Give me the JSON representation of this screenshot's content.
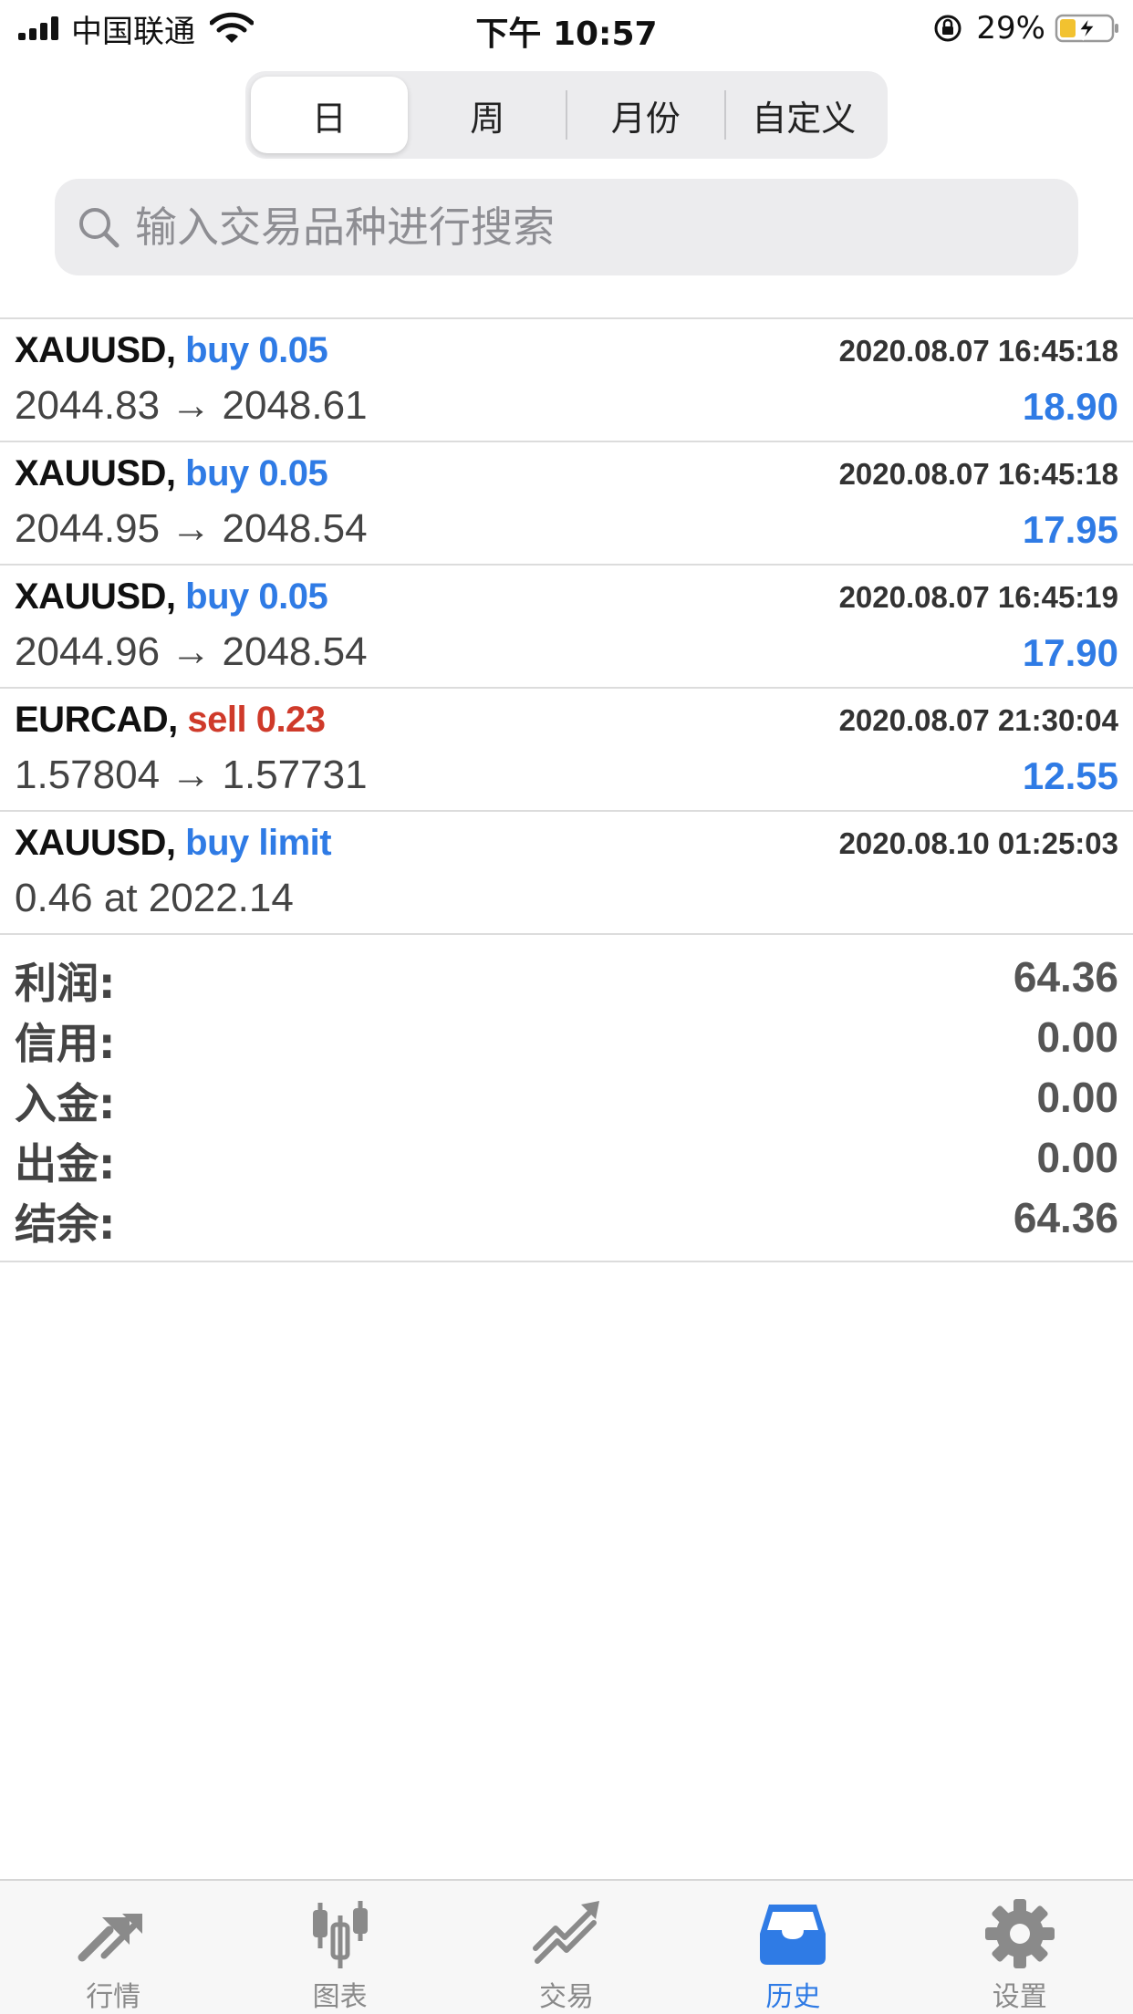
{
  "status_bar": {
    "carrier": "中国联通",
    "time": "下午 10:57",
    "battery_percent": "29%"
  },
  "segment": {
    "tabs": [
      "日",
      "周",
      "月份",
      "自定义"
    ],
    "active_index": 0
  },
  "search": {
    "placeholder": "输入交易品种进行搜索",
    "icon": "search-icon"
  },
  "trades": [
    {
      "symbol": "XAUUSD,",
      "side": "buy 0.05",
      "type": "buy",
      "time": "2020.08.07 16:45:18",
      "prices": "2044.83 → 2048.61",
      "profit": "18.90"
    },
    {
      "symbol": "XAUUSD,",
      "side": "buy 0.05",
      "type": "buy",
      "time": "2020.08.07 16:45:18",
      "prices": "2044.95 → 2048.54",
      "profit": "17.95"
    },
    {
      "symbol": "XAUUSD,",
      "side": "buy 0.05",
      "type": "buy",
      "time": "2020.08.07 16:45:19",
      "prices": "2044.96 → 2048.54",
      "profit": "17.90"
    },
    {
      "symbol": "EURCAD,",
      "side": "sell 0.23",
      "type": "sell",
      "time": "2020.08.07 21:30:04",
      "prices": "1.57804 → 1.57731",
      "profit": "12.55"
    },
    {
      "symbol": "XAUUSD,",
      "side": "buy limit",
      "type": "buy",
      "time": "2020.08.10 01:25:03",
      "prices": "0.46 at 2022.14",
      "profit": ""
    }
  ],
  "summary": [
    {
      "label": "利润:",
      "value": "64.36"
    },
    {
      "label": "信用:",
      "value": "0.00"
    },
    {
      "label": "入金:",
      "value": "0.00"
    },
    {
      "label": "出金:",
      "value": "0.00"
    },
    {
      "label": "结余:",
      "value": "64.36"
    }
  ],
  "tabbar": {
    "items": [
      {
        "label": "行情",
        "icon": "quotes-arrows-icon"
      },
      {
        "label": "图表",
        "icon": "candlestick-chart-icon"
      },
      {
        "label": "交易",
        "icon": "trade-trend-icon"
      },
      {
        "label": "历史",
        "icon": "inbox-tray-icon"
      },
      {
        "label": "设置",
        "icon": "gear-icon"
      }
    ],
    "active_index": 3
  },
  "colors": {
    "accent_blue": "#2f7be5",
    "sell_red": "#cf3a2a",
    "inactive_gray": "#8a8a8a"
  }
}
